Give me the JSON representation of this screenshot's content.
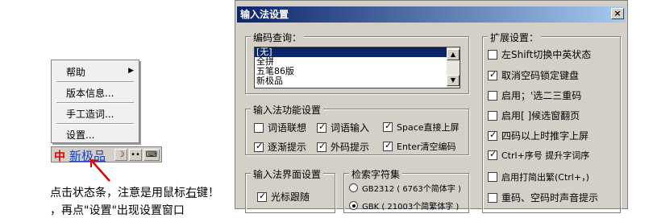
{
  "menu": {
    "items": [
      {
        "label": "帮助",
        "has_submenu": true
      },
      {
        "label": "版本信息..."
      },
      {
        "label": "手工造词..."
      },
      {
        "label": "设置..."
      }
    ]
  },
  "statusbar": {
    "logo": "中",
    "ime_name": "新极品",
    "moon": "☽",
    "punct": "••",
    "keyboard": "⌨"
  },
  "caption": {
    "line1_a": "点击状态条，注意是用鼠标",
    "line1_emph": "右",
    "line1_b": "键！",
    "line2": "，再点\"设置\"出现设置窗口"
  },
  "dialog": {
    "title": "输入法设置",
    "close": "×",
    "encoding_group": {
      "title": "编码查询：",
      "options": [
        "[无]",
        "全拼",
        "五笔86版",
        "新极品"
      ],
      "selected_index": 0
    },
    "function_group": {
      "title": "输入法功能设置",
      "items": [
        {
          "label": "词语联想",
          "checked": false
        },
        {
          "label": "词语输入",
          "checked": true
        },
        {
          "label": "Space直接上屏",
          "checked": true
        },
        {
          "label": "逐渐提示",
          "checked": true
        },
        {
          "label": "外码提示",
          "checked": true
        },
        {
          "label": "Enter清空编码",
          "checked": true
        }
      ]
    },
    "ui_group": {
      "title": "输入法界面设置",
      "items": [
        {
          "label": "光标跟随",
          "checked": true
        }
      ]
    },
    "charset_group": {
      "title": "检索字符集",
      "options": [
        {
          "label": "GB2312 ( 6763个简体字 )",
          "checked": false
        },
        {
          "label": "GBK ( 21003个简繁体字 )",
          "checked": true
        }
      ]
    },
    "ext_group": {
      "title": "扩展设置：",
      "items": [
        {
          "label": "左Shift切换中英状态",
          "checked": false
        },
        {
          "label": "取消空码锁定键盘",
          "checked": true
        },
        {
          "label": "启用；'选二三重码",
          "checked": false
        },
        {
          "label": "启用[ ]候选窗翻页",
          "checked": false
        },
        {
          "label": "四码以上时推字上屏",
          "checked": true
        },
        {
          "label": "Ctrl+序号 提升字词序",
          "checked": true
        },
        {
          "label": "启用打简出繁(Ctrl+，)",
          "checked": false
        },
        {
          "label": "重码、空码时声音提示",
          "checked": false
        }
      ]
    }
  },
  "colors": {
    "title_gradient_start": "#0a246a",
    "title_gradient_end": "#a6caf0",
    "ime_name": "#1e3fb8",
    "arrow": "#e00000"
  }
}
